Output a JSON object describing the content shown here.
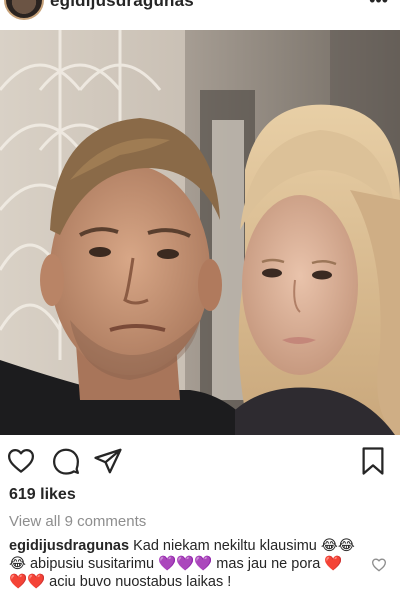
{
  "header": {
    "username": "egidijusdragunas",
    "more_icon": "more-dots-icon",
    "avatar": "profile-avatar"
  },
  "post": {
    "image": "selfie-photo",
    "likes_text": "619 likes",
    "view_comments_text": "View all 9 comments",
    "caption_user": "egidijusdragunas",
    "caption_text": "Kad niekam nekiltu klausimu 😂😂😂 abipusiu susitarimu 💜💜💜 mas jau ne pora ❤️❤️❤️ aciu buvo nuostabus laikas !"
  },
  "actions": {
    "like_icon": "heart-icon",
    "comment_icon": "comment-bubble-icon",
    "share_icon": "paper-plane-icon",
    "save_icon": "bookmark-icon"
  }
}
